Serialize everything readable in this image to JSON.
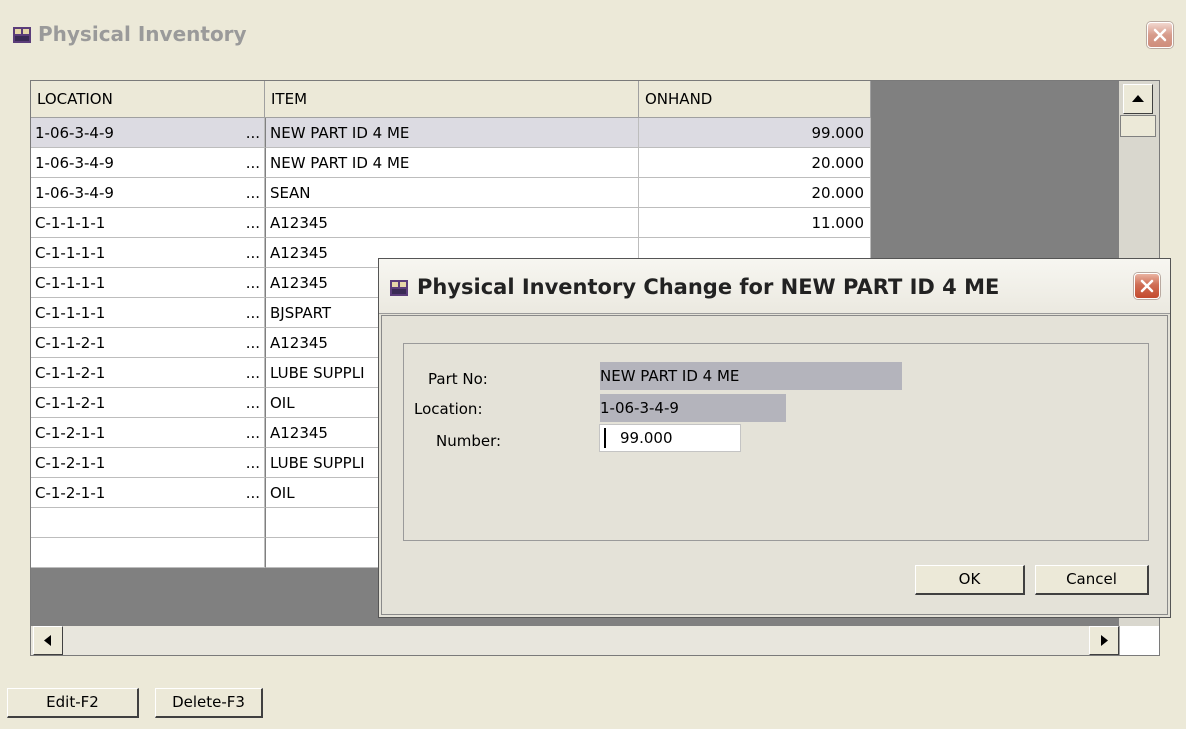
{
  "window": {
    "title": "Physical Inventory"
  },
  "grid": {
    "columns": [
      "LOCATION",
      "ITEM",
      "ONHAND"
    ],
    "rows": [
      {
        "location": "1-06-3-4-9",
        "dots": "...",
        "item": "NEW PART ID 4 ME",
        "onhand": "99.000"
      },
      {
        "location": "1-06-3-4-9",
        "dots": "...",
        "item": "NEW PART ID 4 ME",
        "onhand": "20.000"
      },
      {
        "location": "1-06-3-4-9",
        "dots": "...",
        "item": "SEAN",
        "onhand": "20.000"
      },
      {
        "location": "C-1-1-1-1",
        "dots": "...",
        "item": "A12345",
        "onhand": "11.000"
      },
      {
        "location": "C-1-1-1-1",
        "dots": "...",
        "item": "A12345",
        "onhand": ""
      },
      {
        "location": "C-1-1-1-1",
        "dots": "...",
        "item": "A12345",
        "onhand": ""
      },
      {
        "location": "C-1-1-1-1",
        "dots": "...",
        "item": "BJSPART",
        "onhand": ""
      },
      {
        "location": "C-1-1-2-1",
        "dots": "...",
        "item": "A12345",
        "onhand": ""
      },
      {
        "location": "C-1-1-2-1",
        "dots": "...",
        "item": "LUBE SUPPLI",
        "onhand": ""
      },
      {
        "location": "C-1-1-2-1",
        "dots": "...",
        "item": "OIL",
        "onhand": ""
      },
      {
        "location": "C-1-2-1-1",
        "dots": "...",
        "item": "A12345",
        "onhand": ""
      },
      {
        "location": "C-1-2-1-1",
        "dots": "...",
        "item": "LUBE SUPPLI",
        "onhand": ""
      },
      {
        "location": "C-1-2-1-1",
        "dots": "...",
        "item": "OIL",
        "onhand": ""
      }
    ]
  },
  "buttons": {
    "edit": "Edit-F2",
    "delete": "Delete-F3"
  },
  "dialog": {
    "title": "Physical Inventory Change for NEW PART ID 4 ME",
    "part_no_label": "Part No:",
    "part_no": "NEW PART ID 4 ME",
    "location_label": "Location:",
    "location": "1-06-3-4-9",
    "number_label": "Number:",
    "number": "99.000",
    "ok": "OK",
    "cancel": "Cancel"
  },
  "colors": {
    "title_close": "#c44a2e",
    "selected_row": "#dcdbe2",
    "grid_bg": "#808080",
    "readonly_field": "#b4b4bc"
  },
  "icons": [
    "app-icon",
    "close-icon",
    "scroll-up-icon",
    "scroll-left-icon",
    "scroll-right-icon"
  ]
}
